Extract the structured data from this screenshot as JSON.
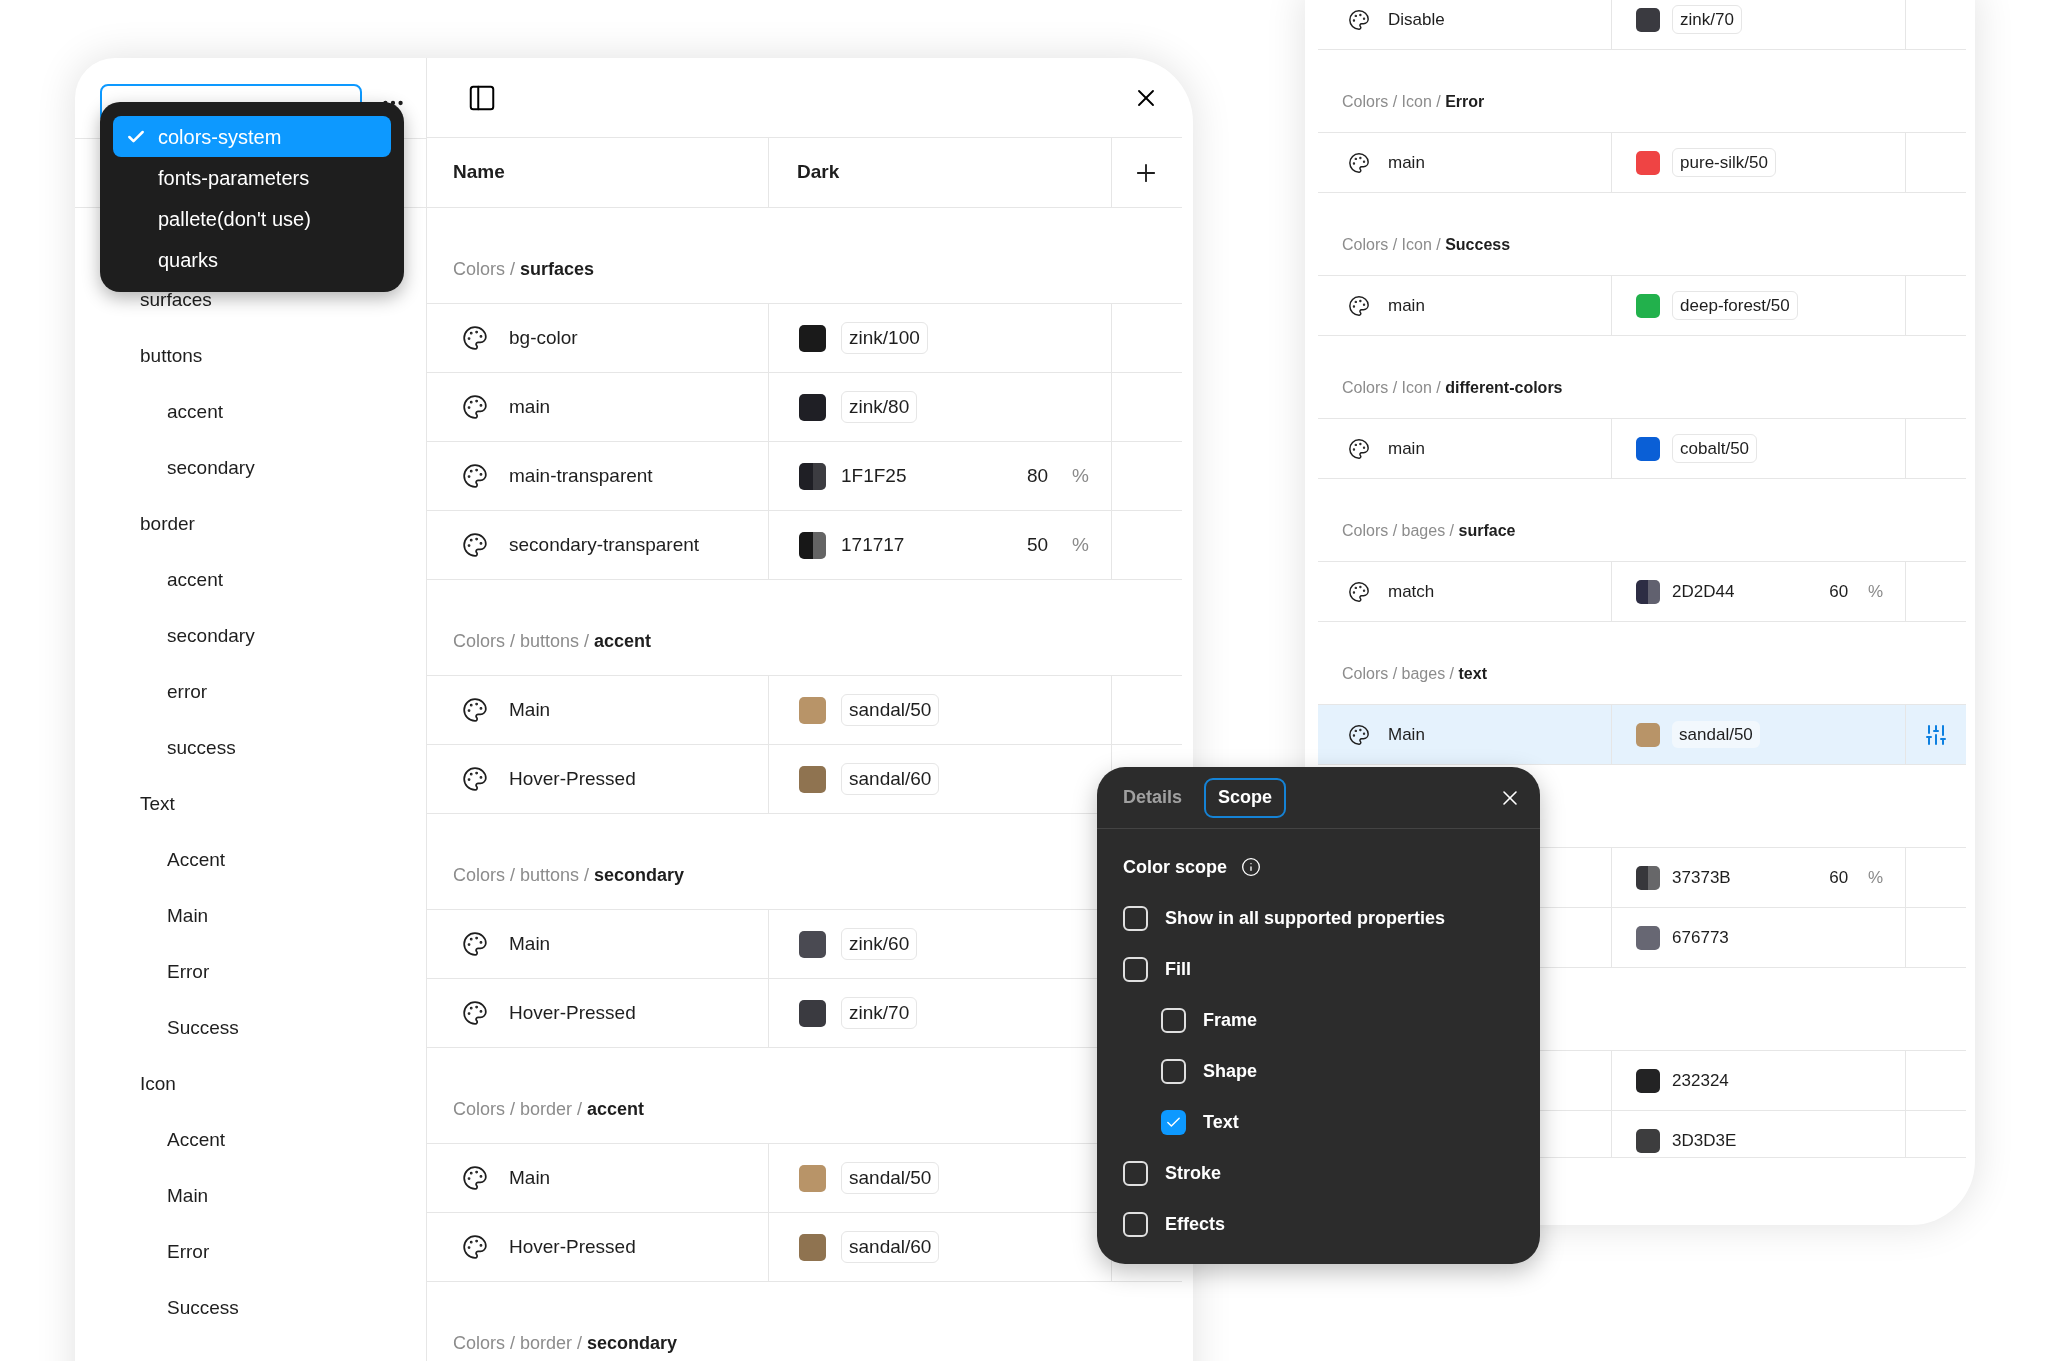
{
  "left_window": {
    "sidebar": {
      "dropdown": {
        "options": [
          {
            "label": "colors-system",
            "selected": true
          },
          {
            "label": "fonts-parameters",
            "selected": false
          },
          {
            "label": "pallete(don't use)",
            "selected": false
          },
          {
            "label": "quarks",
            "selected": false
          }
        ]
      },
      "items": [
        {
          "label": "surfaces"
        },
        {
          "label": "buttons",
          "children": [
            {
              "label": "accent"
            },
            {
              "label": "secondary"
            }
          ]
        },
        {
          "label": "border",
          "children": [
            {
              "label": "accent"
            },
            {
              "label": "secondary"
            },
            {
              "label": "error"
            },
            {
              "label": "success"
            }
          ]
        },
        {
          "label": "Text",
          "children": [
            {
              "label": "Accent"
            },
            {
              "label": "Main"
            },
            {
              "label": "Error"
            },
            {
              "label": "Success"
            }
          ]
        },
        {
          "label": "Icon",
          "children": [
            {
              "label": "Accent"
            },
            {
              "label": "Main"
            },
            {
              "label": "Error"
            },
            {
              "label": "Success"
            }
          ]
        }
      ]
    },
    "table": {
      "columns": [
        "Name",
        "Dark"
      ],
      "groups": [
        {
          "title": "Colors / **surfaces**",
          "rows": [
            {
              "name": "bg-color",
              "kind": "alias",
              "color": "#1a1a1a",
              "value": "zink/100",
              "selected": false
            },
            {
              "name": "main",
              "kind": "alias",
              "color": "#1f1f25",
              "value": "zink/80",
              "selected": false
            },
            {
              "name": "main-transparent",
              "kind": "hex",
              "color": "#1f1f25",
              "value": "1F1F25",
              "opacity": "80",
              "unit": "%",
              "selected": false
            },
            {
              "name": "secondary-transparent",
              "kind": "hex",
              "color": "#171717",
              "value": "171717",
              "opacity": "50",
              "unit": "%",
              "selected": false
            }
          ]
        },
        {
          "title": "Colors / buttons / **accent**",
          "rows": [
            {
              "name": "Main",
              "kind": "alias",
              "color": "#b89468",
              "value": "sandal/50",
              "selected": false
            },
            {
              "name": "Hover-Pressed",
              "kind": "alias",
              "color": "#8f7350",
              "value": "sandal/60",
              "selected": false
            }
          ]
        },
        {
          "title": "Colors / buttons / **secondary**",
          "rows": [
            {
              "name": "Main",
              "kind": "alias",
              "color": "#4a4a52",
              "value": "zink/60",
              "selected": false
            },
            {
              "name": "Hover-Pressed",
              "kind": "alias",
              "color": "#3a3a40",
              "value": "zink/70",
              "selected": false
            }
          ]
        },
        {
          "title": "Colors / border / **accent**",
          "rows": [
            {
              "name": "Main",
              "kind": "alias",
              "color": "#b89468",
              "value": "sandal/50",
              "selected": false
            },
            {
              "name": "Hover-Pressed",
              "kind": "alias",
              "color": "#8f7350",
              "value": "sandal/60",
              "selected": false
            }
          ]
        },
        {
          "title": "Colors / border / **secondary**"
        }
      ]
    }
  },
  "right_window": {
    "groups": [
      {
        "rows": [
          {
            "name": "Disable",
            "kind": "alias",
            "color": "#3a3a40",
            "value": "zink/70",
            "selected": false
          }
        ]
      },
      {
        "title": "Colors / Icon / **Error**",
        "rows": [
          {
            "name": "main",
            "kind": "alias",
            "color": "#ef4444",
            "value": "pure-silk/50",
            "selected": false
          }
        ]
      },
      {
        "title": "Colors / Icon / **Success**",
        "rows": [
          {
            "name": "main",
            "kind": "alias",
            "color": "#22b14c",
            "value": "deep-forest/50",
            "selected": false
          }
        ]
      },
      {
        "title": "Colors / Icon / **different-colors**",
        "rows": [
          {
            "name": "main",
            "kind": "alias",
            "color": "#0a5fd6",
            "value": "cobalt/50",
            "selected": false
          }
        ]
      },
      {
        "title": "Colors / bages / **surface**",
        "rows": [
          {
            "name": "match",
            "kind": "hex",
            "color": "#2d2d44",
            "value": "2D2D44",
            "opacity": "60",
            "unit": "%",
            "selected": false
          }
        ]
      },
      {
        "title": "Colors / bages / **text**",
        "rows": [
          {
            "name": "Main",
            "kind": "alias",
            "color": "#b89468",
            "value": "sandal/50",
            "selected": true
          }
        ]
      },
      {
        "rows": [
          {
            "kind": "hex",
            "color": "#37373b",
            "value": "37373B",
            "opacity": "60",
            "unit": "%",
            "selected": false
          },
          {
            "kind": "hex",
            "color": "#676773",
            "value": "676773",
            "selected": false
          }
        ]
      },
      {
        "rows": [
          {
            "kind": "hex",
            "color": "#232324",
            "value": "232324",
            "selected": false
          },
          {
            "kind": "hex",
            "color": "#3d3d3e",
            "value": "3D3D3E",
            "selected": false
          }
        ]
      }
    ]
  },
  "scope_popup": {
    "tabs": [
      {
        "label": "Details",
        "selected": false
      },
      {
        "label": "Scope",
        "selected": true
      }
    ],
    "section_title": "Color scope",
    "options": [
      {
        "label": "Show in all supported properties",
        "checked": false
      },
      {
        "label": "Fill",
        "checked": false,
        "children": [
          {
            "label": "Frame",
            "checked": false
          },
          {
            "label": "Shape",
            "checked": false
          },
          {
            "label": "Text",
            "checked": true
          }
        ]
      },
      {
        "label": "Stroke",
        "checked": false
      },
      {
        "label": "Effects",
        "checked": false
      }
    ]
  }
}
